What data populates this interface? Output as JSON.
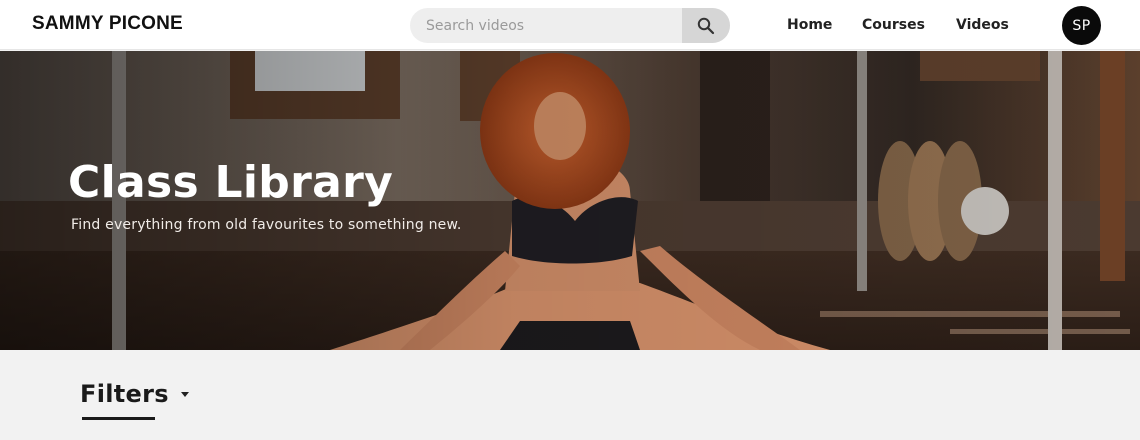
{
  "header": {
    "brand": "SAMMY PICONE",
    "search": {
      "placeholder": "Search videos",
      "icon": "search-icon"
    },
    "nav": [
      {
        "label": "Home"
      },
      {
        "label": "Courses"
      },
      {
        "label": "Videos"
      }
    ],
    "avatar": {
      "initials": "SP"
    }
  },
  "hero": {
    "title": "Class Library",
    "subtitle": "Find everything from old favourites to something new."
  },
  "filters": {
    "label": "Filters",
    "icon": "caret-down-icon"
  },
  "colors": {
    "header_bg": "#ffffff",
    "avatar_bg": "#0a0a0a",
    "page_bg": "#f2f2f2",
    "search_bg": "#eeeeee",
    "search_button_bg": "#d6d6d6"
  }
}
